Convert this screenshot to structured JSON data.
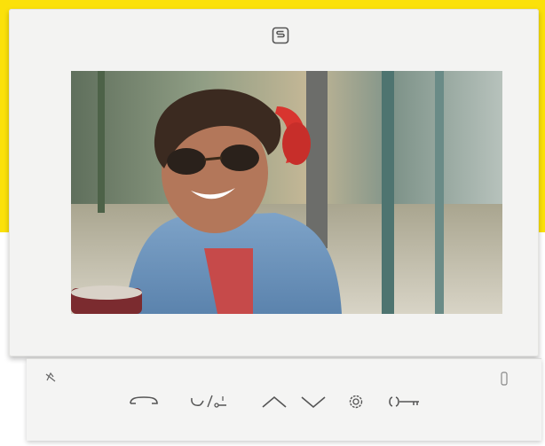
{
  "device": {
    "logo_icon": "s-logo-icon",
    "brand_color": "#fbe10a"
  },
  "screen": {
    "content": "video-feed"
  },
  "controls": [
    {
      "name": "handset-button",
      "icon": "handset-icon"
    },
    {
      "name": "door-release-button",
      "icon": "door-release-icon"
    },
    {
      "name": "up-button",
      "icon": "chevron-up-icon"
    },
    {
      "name": "down-button",
      "icon": "chevron-down-icon"
    },
    {
      "name": "settings-button",
      "icon": "gear-icon"
    },
    {
      "name": "key-button",
      "icon": "key-icon"
    }
  ],
  "indicators": [
    {
      "name": "mute-indicator",
      "icon": "mute-icon"
    },
    {
      "name": "status-led",
      "icon": "led-icon"
    }
  ]
}
